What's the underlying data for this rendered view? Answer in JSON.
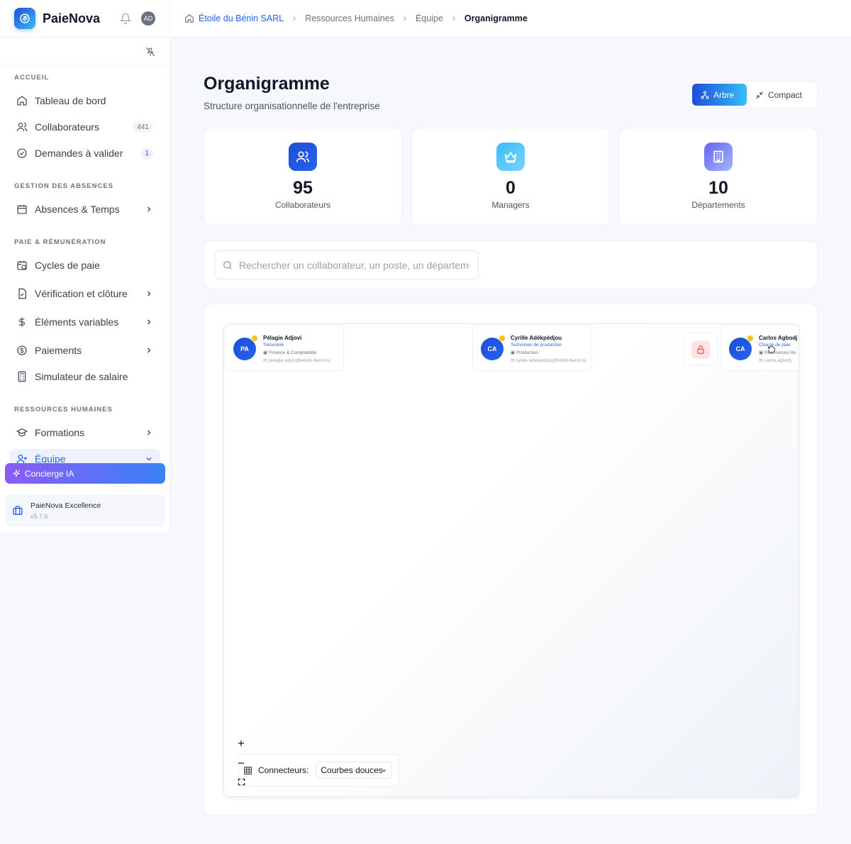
{
  "app": {
    "name": "PaieNova",
    "user_initials": "AD"
  },
  "sidebar": {
    "sections": [
      {
        "title": "ACCUEIL",
        "items": [
          {
            "label": "Tableau de bord",
            "icon": "home-icon"
          },
          {
            "label": "Collaborateurs",
            "icon": "users-icon",
            "badge": "441"
          },
          {
            "label": "Demandes à valider",
            "icon": "check-circle-icon",
            "badge": "1"
          }
        ]
      },
      {
        "title": "GESTION DES ABSENCES",
        "items": [
          {
            "label": "Absences & Temps",
            "icon": "calendar-icon"
          }
        ]
      },
      {
        "title": "PAIE & RÉMUNÉRATION",
        "items": [
          {
            "label": "Cycles de paie",
            "icon": "calendar-clock-icon"
          },
          {
            "label": "Vérification et clôture",
            "icon": "file-check-icon"
          },
          {
            "label": "Éléments variables",
            "icon": "dollar-icon"
          },
          {
            "label": "Paiements",
            "icon": "coin-icon"
          },
          {
            "label": "Simulateur de salaire",
            "icon": "calculator-icon"
          }
        ]
      },
      {
        "title": "RESSOURCES HUMAINES",
        "items": [
          {
            "label": "Formations",
            "icon": "graduation-cap-icon"
          },
          {
            "label": "Équipe",
            "icon": "user-plus-icon"
          }
        ]
      }
    ],
    "concierge_label": "Concierge IA",
    "version_title": "PaieNova Excellence",
    "version_number": "v5.7.6"
  },
  "breadcrumb": [
    "Étoile du Bénin SARL",
    "Ressources Humaines",
    "Équipe",
    "Organigramme"
  ],
  "page": {
    "title": "Organigramme",
    "subtitle": "Structure organisationnelle de l'entreprise",
    "view_tree": "Arbre",
    "view_compact": "Compact"
  },
  "stats": [
    {
      "value": "95",
      "label": "Collaborateurs",
      "icon": "users-icon",
      "color": "#1d4ed8"
    },
    {
      "value": "0",
      "label": "Managers",
      "icon": "crown-icon",
      "color": "#38bdf8"
    },
    {
      "value": "10",
      "label": "Départements",
      "icon": "building-icon",
      "color": "#818cf8"
    }
  ],
  "search": {
    "placeholder": "Rechercher un collaborateur, un poste, un département..."
  },
  "nodes": [
    {
      "initials": "PA",
      "name": "Pélagie Adjovi",
      "role": "Trésorière",
      "dept": "Finance & Comptabilité",
      "email": "pelagie.adjovi@etoile-benin.bj"
    },
    {
      "initials": "CA",
      "name": "Cyrille Adékpédjou",
      "role": "Technicien de production",
      "dept": "Production",
      "email": "cyrille.adekpedjou@etoile-benin.bj"
    },
    {
      "initials": "CA",
      "name": "Carlos Agbodj",
      "role": "Chargé de paie",
      "dept": "Ressources Hu",
      "email": "carlos.agbodj"
    }
  ],
  "connectors": {
    "label": "Connecteurs:",
    "value": "Courbes douces"
  }
}
